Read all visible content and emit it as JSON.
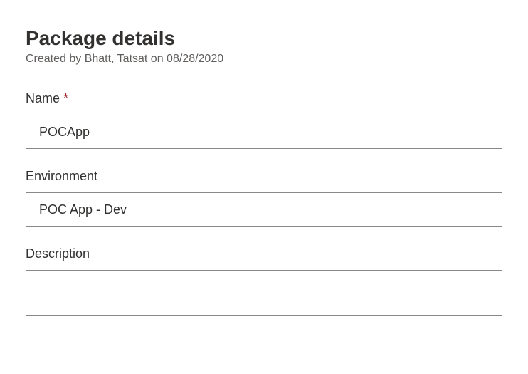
{
  "header": {
    "title": "Package details",
    "subtitle": "Created by Bhatt, Tatsat on 08/28/2020"
  },
  "fields": {
    "name": {
      "label": "Name",
      "required": "*",
      "value": "POCApp"
    },
    "environment": {
      "label": "Environment",
      "value": "POC App - Dev"
    },
    "description": {
      "label": "Description",
      "value": ""
    }
  }
}
